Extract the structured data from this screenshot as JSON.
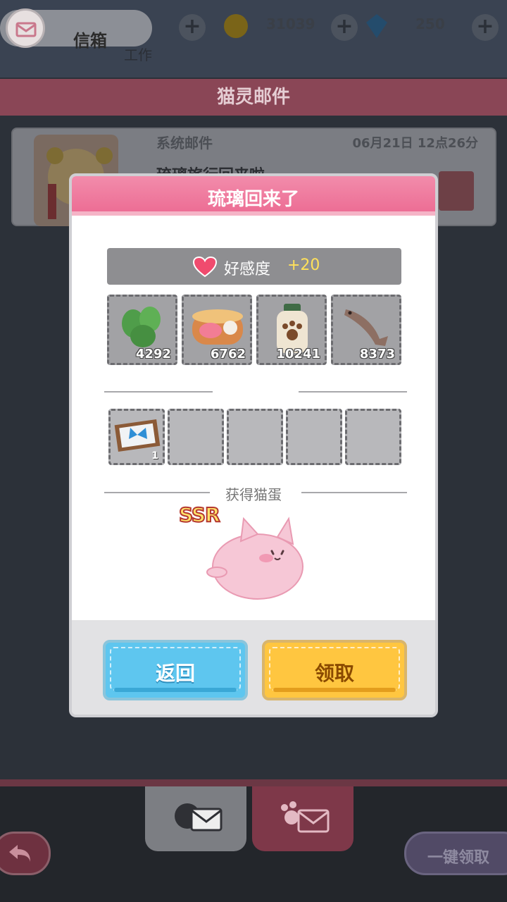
{
  "header": {
    "mailbox_label": "信箱",
    "coins": "31039",
    "gems": "250",
    "work_label": "工作"
  },
  "page_title": "猫灵邮件",
  "mail": {
    "type": "系统邮件",
    "date": "06月21日 12点26分",
    "subject": "琉璃旅行回来啦~"
  },
  "modal": {
    "title": "琉璃回来了",
    "affinity_label": "好感度",
    "affinity_value": "+20",
    "items": [
      {
        "name": "mint-leaves-icon",
        "count": "4292"
      },
      {
        "name": "fish-can-icon",
        "count": "6762"
      },
      {
        "name": "paw-jar-icon",
        "count": "10241"
      },
      {
        "name": "dried-fish-icon",
        "count": "8373"
      }
    ],
    "slots": [
      {
        "name": "butterfly-frame-icon",
        "count": "1"
      }
    ],
    "egg_label": "获得猫蛋",
    "rarity": "SSR",
    "back_button": "返回",
    "claim_button": "领取"
  },
  "bottom": {
    "claim_all": "一键领取"
  },
  "colors": {
    "modal_header": "#ec6a92",
    "back_button": "#5ec6ef",
    "claim_button": "#ffc640",
    "affinity_value": "#ffe15a"
  }
}
